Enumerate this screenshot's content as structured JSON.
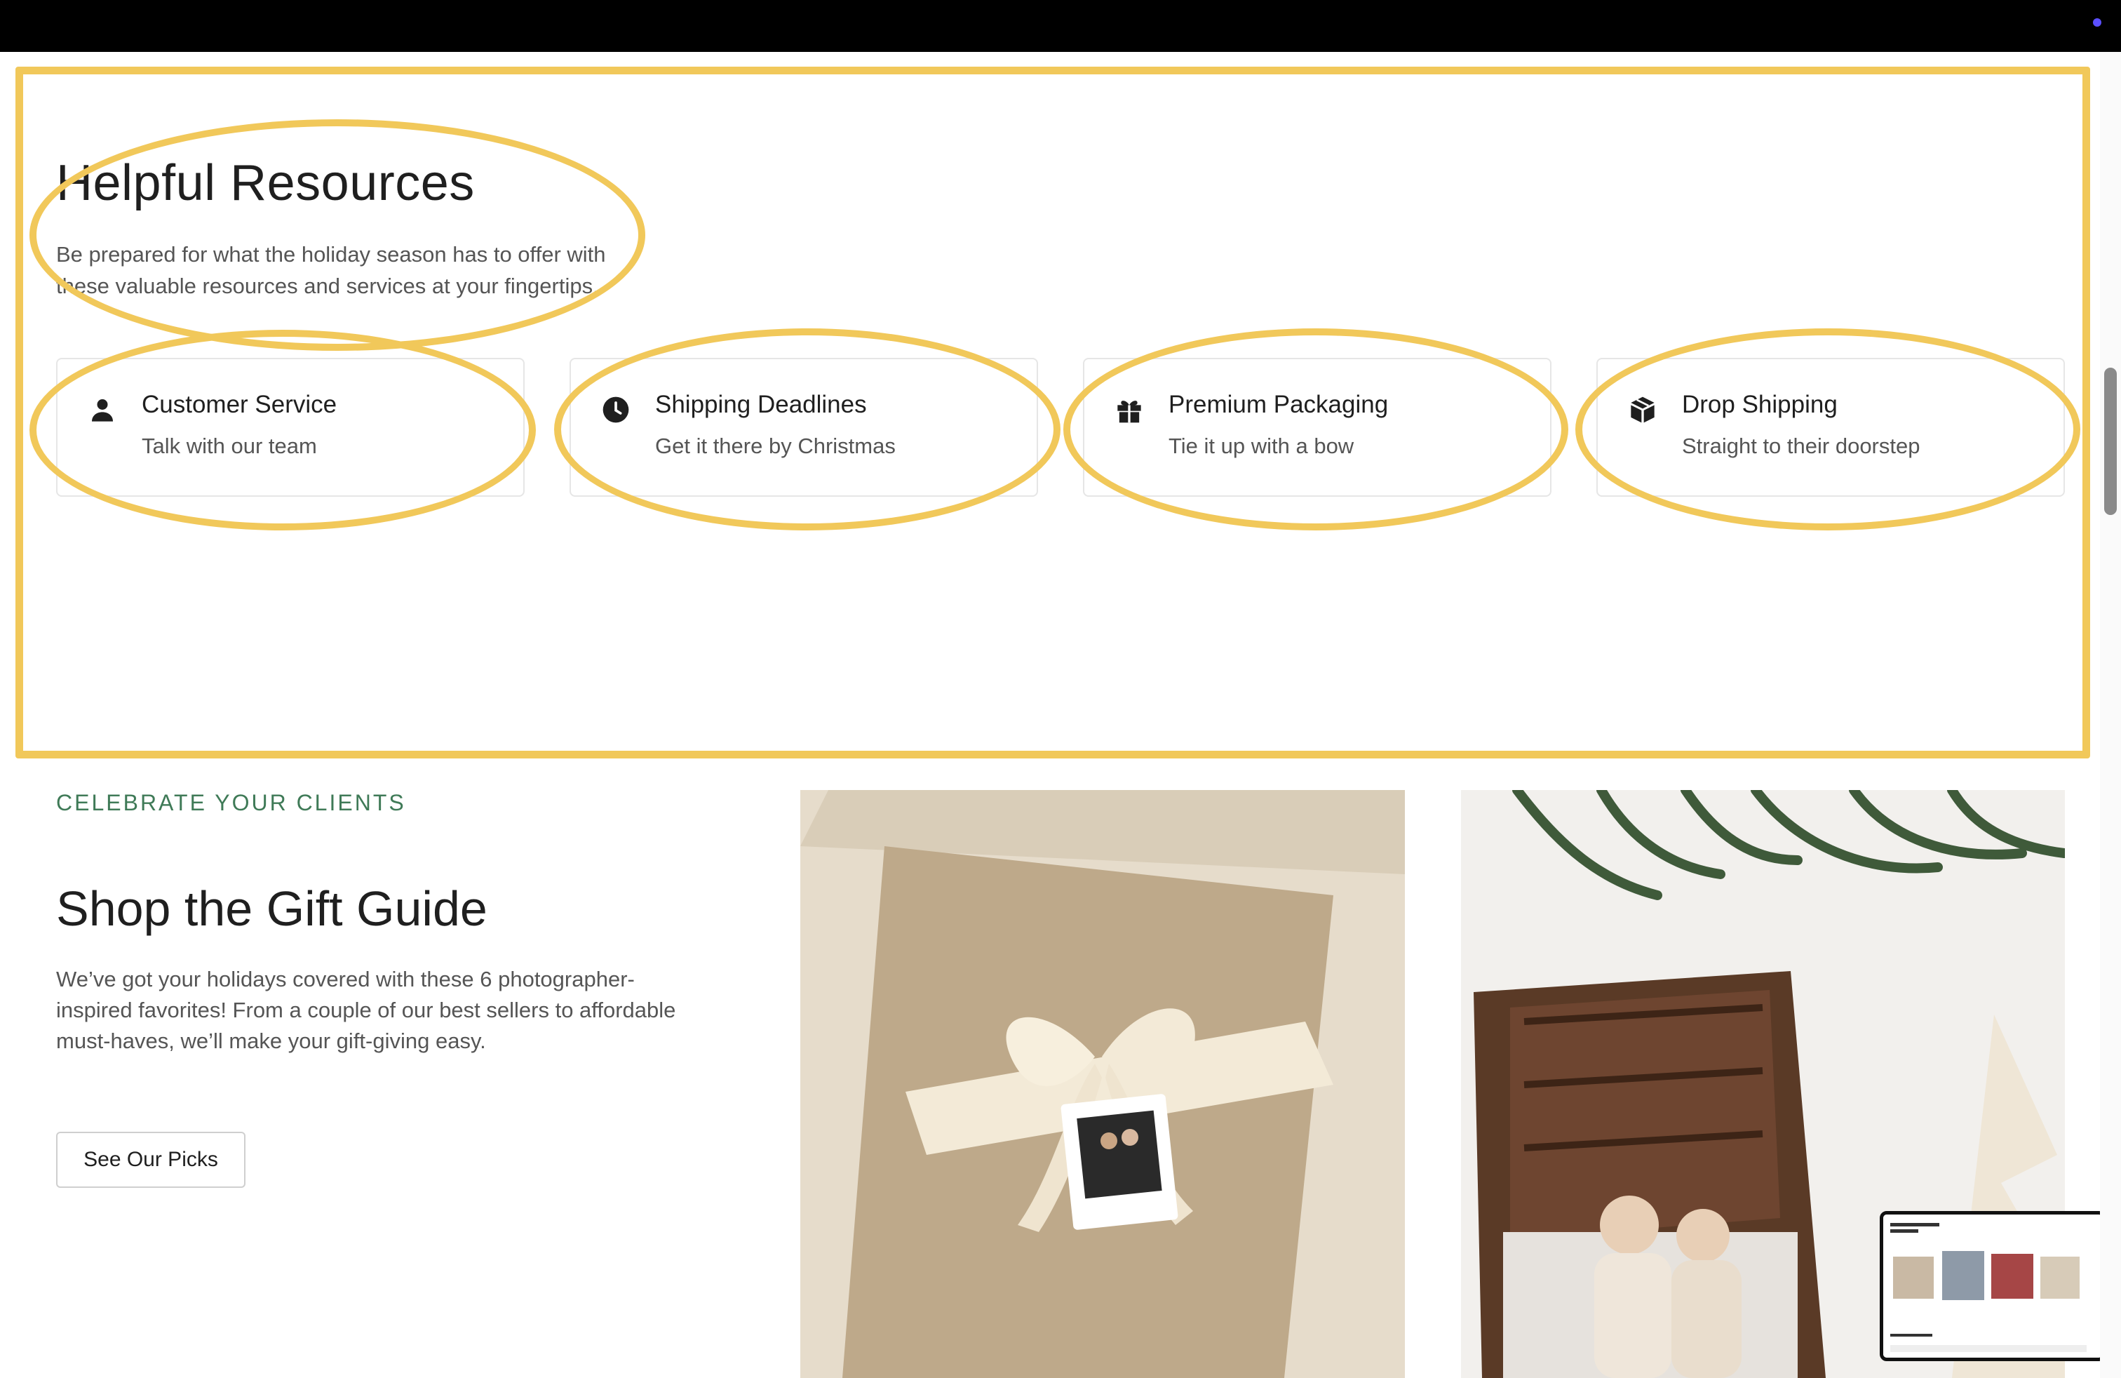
{
  "resources": {
    "title": "Helpful Resources",
    "description": "Be prepared for what the holiday season has to offer with these valuable resources and services at your fingertips.",
    "cards": [
      {
        "icon": "person-icon",
        "title": "Customer Service",
        "subtitle": "Talk with our team"
      },
      {
        "icon": "clock-icon",
        "title": "Shipping Deadlines",
        "subtitle": "Get it there by Christmas"
      },
      {
        "icon": "gift-icon",
        "title": "Premium Packaging",
        "subtitle": "Tie it up with a bow"
      },
      {
        "icon": "box-icon",
        "title": "Drop Shipping",
        "subtitle": "Straight to their doorstep"
      }
    ]
  },
  "gift_guide": {
    "eyebrow": "CELEBRATE YOUR CLIENTS",
    "title": "Shop the Gift Guide",
    "description": "We’ve got your holidays covered with these 6 photographer-inspired favorites! From a couple of our best sellers to affordable must-haves, we’ll make your gift-giving easy.",
    "button_label": "See Our Picks"
  },
  "colors": {
    "annotation": "#f1c85a",
    "eyebrow_green": "#3f7a57",
    "accent_dot": "#5b4fff"
  }
}
